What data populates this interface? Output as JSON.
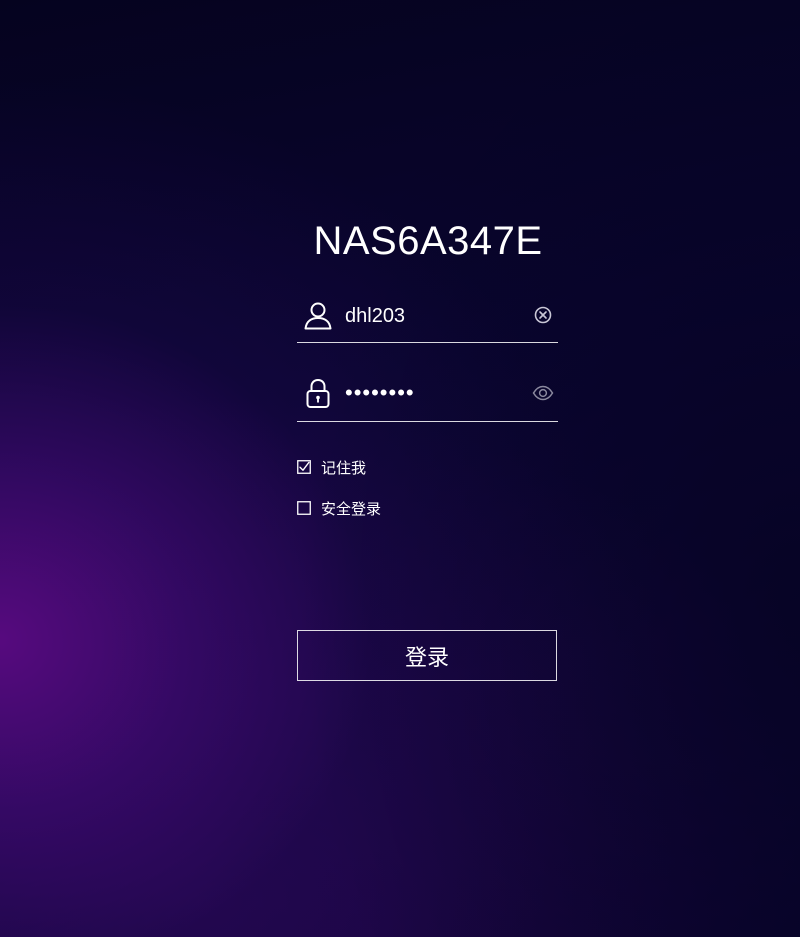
{
  "device_name": "NAS6A347E",
  "username": {
    "value": "dhl203",
    "icon": "user-icon",
    "clear_icon": "clear-circle-icon"
  },
  "password": {
    "masked_value": "••••••••",
    "icon": "lock-icon",
    "toggle_icon": "eye-icon"
  },
  "remember_me": {
    "label": "记住我",
    "checked": true
  },
  "secure_login": {
    "label": "安全登录",
    "checked": false
  },
  "login_button": {
    "label": "登录"
  },
  "colors": {
    "text": "#ffffff",
    "background_dark": "#0a0530",
    "accent_purple": "#5a0a82",
    "icon_muted": "#9a98b0"
  }
}
